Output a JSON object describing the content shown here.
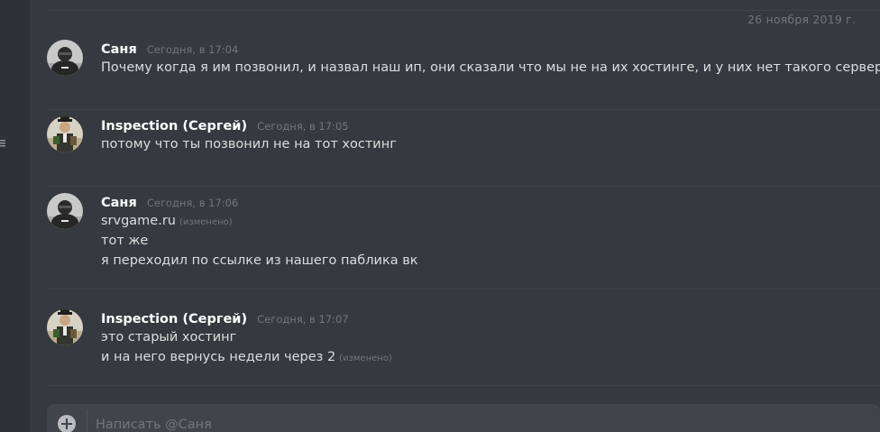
{
  "date_divider": "26 ноября 2019 г.",
  "messages": [
    {
      "author": "Саня",
      "time": "Сегодня, в 17:04",
      "lines": [
        {
          "text": "Почему когда я им позвонил, и назвал наш ип, они сказали что мы не на их хостинге, и у них нет такого сервера",
          "edited": ""
        }
      ]
    },
    {
      "author": "Inspection (Сергей)",
      "time": "Сегодня, в 17:05",
      "lines": [
        {
          "text": "потому что ты позвонил не на тот хостинг",
          "edited": ""
        }
      ]
    },
    {
      "author": "Саня",
      "time": "Сегодня, в 17:06",
      "lines": [
        {
          "text": "srvgame.ru",
          "edited": "(изменено)"
        },
        {
          "text": "тот же",
          "edited": ""
        },
        {
          "text": "я переходил по ссылке из нашего паблика вк",
          "edited": ""
        }
      ]
    },
    {
      "author": "Inspection (Сергей)",
      "time": "Сегодня, в 17:07",
      "lines": [
        {
          "text": "это старый хостинг",
          "edited": ""
        },
        {
          "text": "и на него вернусь недели через 2",
          "edited": "(изменено)"
        }
      ]
    }
  ],
  "composer": {
    "placeholder": "Написать @Саня",
    "attach_icon": "plus-circle-icon"
  }
}
